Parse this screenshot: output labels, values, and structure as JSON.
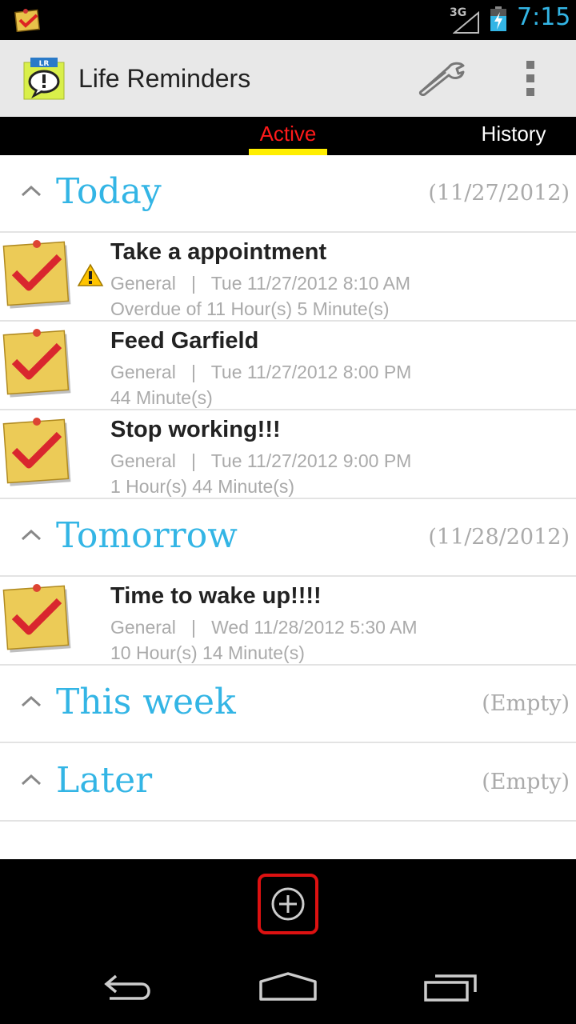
{
  "status_bar": {
    "network": "3G",
    "time": "7:15",
    "icons": [
      "notification-check-icon",
      "signal-icon",
      "battery-charging-icon"
    ]
  },
  "action_bar": {
    "title": "Life Reminders",
    "app_icon": "life-reminders-logo",
    "app_icon_text": "LR",
    "actions": [
      "wrench-icon",
      "overflow-menu-icon"
    ]
  },
  "tabs": [
    {
      "label": "Active",
      "selected": true
    },
    {
      "label": "History",
      "selected": false
    }
  ],
  "colors": {
    "accent": "#33b5e5",
    "active_tab": "#ff1a1a",
    "tab_indicator": "#ffee00",
    "add_button_border": "#dd1111"
  },
  "sections": [
    {
      "title": "Today",
      "date": "(11/27/2012)",
      "items": [
        {
          "title": "Take a appointment",
          "meta": "General   |   Tue 11/27/2012 8:10 AM",
          "remain": "Overdue of 11 Hour(s) 5 Minute(s)",
          "warning": true
        },
        {
          "title": "Feed Garfield",
          "meta": "General   |   Tue 11/27/2012 8:00 PM",
          "remain": "44 Minute(s)",
          "warning": false
        },
        {
          "title": "Stop working!!!",
          "meta": "General   |   Tue 11/27/2012 9:00 PM",
          "remain": "1 Hour(s) 44 Minute(s)",
          "warning": false
        }
      ]
    },
    {
      "title": "Tomorrow",
      "date": "(11/28/2012)",
      "items": [
        {
          "title": "Time to wake up!!!!",
          "meta": "General   |   Wed 11/28/2012 5:30 AM",
          "remain": "10 Hour(s) 14 Minute(s)",
          "warning": false
        }
      ]
    },
    {
      "title": "This week",
      "date": "(Empty)",
      "items": []
    },
    {
      "title": "Later",
      "date": "(Empty)",
      "items": []
    }
  ],
  "bottom_bar": {
    "add_icon": "add-circle-icon"
  },
  "nav_bar": [
    "back-icon",
    "home-icon",
    "recent-apps-icon"
  ]
}
